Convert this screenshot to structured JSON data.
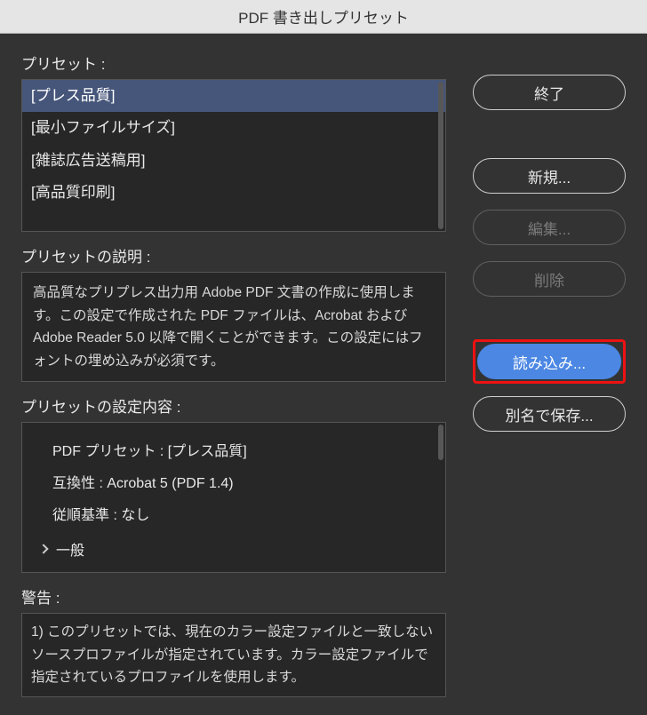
{
  "title": "PDF 書き出しプリセット",
  "labels": {
    "presets": "プリセット :",
    "description": "プリセットの説明 :",
    "settings": "プリセットの設定内容 :",
    "warnings": "警告 :"
  },
  "presets": {
    "items": [
      {
        "name": "[プレス品質]",
        "selected": true
      },
      {
        "name": "[最小ファイルサイズ]",
        "selected": false
      },
      {
        "name": "[雑誌広告送稿用]",
        "selected": false
      },
      {
        "name": "[高品質印刷]",
        "selected": false
      }
    ]
  },
  "description_text": "高品質なプリプレス出力用 Adobe PDF 文書の作成に使用します。この設定で作成された PDF ファイルは、Acrobat および Adobe Reader 5.0 以降で開くことができます。この設定にはフォントの埋め込みが必須です。",
  "settings": {
    "rows": [
      "PDF プリセット : [プレス品質]",
      "互換性 : Acrobat 5 (PDF 1.4)",
      "従順基準 : なし"
    ],
    "collapse": "一般"
  },
  "warning_text": "1) このプリセットでは、現在のカラー設定ファイルと一致しないソースプロファイルが指定されています。カラー設定ファイルで指定されているプロファイルを使用します。",
  "buttons": {
    "done": "終了",
    "new": "新規...",
    "edit": "編集...",
    "delete": "削除",
    "load": "読み込み...",
    "save_as": "別名で保存..."
  }
}
